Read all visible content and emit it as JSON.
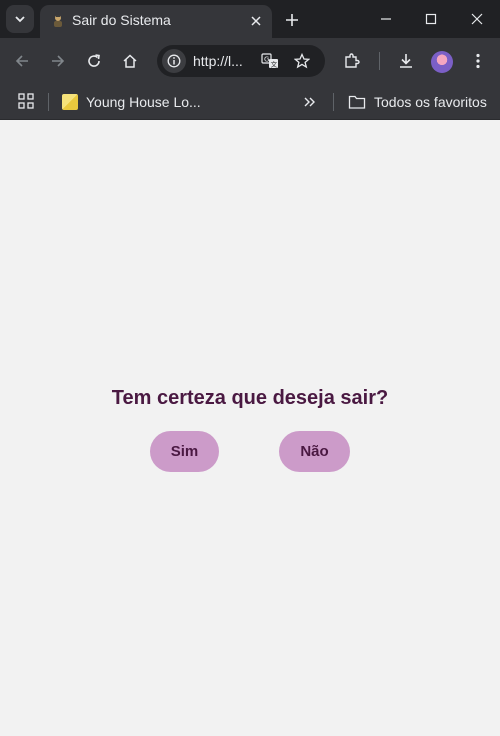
{
  "browser": {
    "tab": {
      "title": "Sair do Sistema"
    },
    "address_bar": {
      "url": "http://l..."
    },
    "bookmarks": {
      "items": [
        {
          "label": "Young House Lo..."
        }
      ],
      "folder_label": "Todos os favoritos"
    }
  },
  "icons": {
    "tab_search": "chevron-down-icon",
    "close": "close-icon",
    "new_tab": "plus-icon",
    "minimize": "minimize-icon",
    "maximize": "maximize-icon",
    "window_close": "window-close-icon",
    "back": "arrow-left-icon",
    "forward": "arrow-right-icon",
    "reload": "reload-icon",
    "home": "home-icon",
    "site_info": "info-icon",
    "translate": "translate-icon",
    "star": "star-icon",
    "extensions": "puzzle-icon",
    "downloads": "download-icon",
    "menu": "kebab-menu-icon",
    "apps": "apps-grid-icon",
    "more_bookmarks": "double-chevron-icon",
    "folder": "folder-icon"
  },
  "dialog": {
    "question": "Tem certeza que deseja sair?",
    "yes_label": "Sim",
    "no_label": "Não"
  },
  "colors": {
    "page_background": "#f2f2f2",
    "text_accent": "#4a1942",
    "button_background": "#cc9bc9",
    "browser_frame": "#202124",
    "browser_toolbar": "#35363a"
  }
}
